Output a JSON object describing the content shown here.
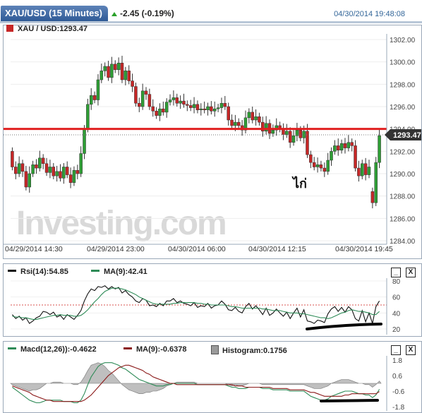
{
  "header": {
    "instrument_tab": "XAU/USD (15 Minutes)",
    "change": "-2.45 (-0.19%)",
    "timestamp": "04/30/2014 19:48:08"
  },
  "main_chart": {
    "symbol_label": "XAU / USD:1293.47",
    "last_price_tag": "1293.47",
    "annotation_text": "ไก่",
    "watermark": "Investing.com"
  },
  "rsi_panel": {
    "rsi_label": "Rsi(14):54.85",
    "ma_label": "MA(9):42.41"
  },
  "macd_panel": {
    "macd_label": "Macd(12,26)):-0.4622",
    "ma_label": "MA(9):-0.6378",
    "histogram_label": "Histogram:0.1756"
  },
  "buttons": {
    "minimize": "_",
    "close": "X"
  },
  "colors": {
    "bull": "#2e9e35",
    "bear": "#c62727",
    "support_line": "#e02020",
    "rsi_line": "#111111",
    "ma_line": "#2e8b57",
    "macd_signal": "#8b1a1a",
    "accent": "#336699"
  },
  "chart_data": [
    {
      "type": "candlestick",
      "title": "XAU / USD:1293.47",
      "x_tick_labels": [
        "04/29/2014 14:30",
        "04/29/2014 23:00",
        "04/30/2014 06:00",
        "04/30/2014 12:15",
        "04/30/2014 19:45"
      ],
      "y_tick_labels": [
        "1302.00",
        "1300.00",
        "1298.00",
        "1296.00",
        "1294.00",
        "1292.00",
        "1290.00",
        "1288.00",
        "1286.00",
        "1284.00"
      ],
      "ylim": [
        1284,
        1302
      ],
      "horizontal_line": 1294.0,
      "last_price": 1293.47,
      "close": [
        1290.6,
        1290.0,
        1290.9,
        1290.2,
        1288.8,
        1290.0,
        1290.8,
        1290.5,
        1291.4,
        1290.9,
        1290.1,
        1290.6,
        1289.8,
        1290.2,
        1289.6,
        1290.6,
        1289.9,
        1289.2,
        1290.3,
        1290.0,
        1291.8,
        1294.0,
        1296.2,
        1297.0,
        1296.6,
        1298.4,
        1299.2,
        1299.6,
        1298.6,
        1299.8,
        1299.3,
        1299.9,
        1298.4,
        1299.2,
        1298.3,
        1297.8,
        1296.3,
        1296.0,
        1297.4,
        1297.1,
        1296.0,
        1295.6,
        1295.2,
        1295.8,
        1295.5,
        1296.4,
        1296.6,
        1296.8,
        1296.3,
        1296.5,
        1296.2,
        1296.1,
        1295.9,
        1296.2,
        1295.7,
        1295.8,
        1295.7,
        1296.0,
        1295.6,
        1295.8,
        1295.9,
        1296.3,
        1296.0,
        1294.8,
        1294.3,
        1294.6,
        1294.3,
        1293.9,
        1295.0,
        1295.5,
        1294.8,
        1295.1,
        1294.6,
        1293.8,
        1294.5,
        1293.6,
        1293.9,
        1294.3,
        1294.0,
        1293.5,
        1293.8,
        1292.8,
        1293.4,
        1293.9,
        1293.2,
        1293.8,
        1291.7,
        1291.0,
        1290.6,
        1290.8,
        1290.5,
        1290.2,
        1291.2,
        1292.0,
        1292.5,
        1292.1,
        1292.7,
        1292.3,
        1292.8,
        1292.5,
        1290.5,
        1289.8,
        1290.9,
        1289.9,
        1290.6,
        1287.4,
        1291.0,
        1293.4
      ],
      "open": [
        1292.0,
        1290.6,
        1290.0,
        1290.9,
        1290.2,
        1288.8,
        1290.0,
        1290.8,
        1290.5,
        1291.4,
        1290.9,
        1290.1,
        1290.6,
        1289.8,
        1290.2,
        1289.6,
        1290.6,
        1289.9,
        1289.2,
        1290.3,
        1290.0,
        1291.8,
        1294.0,
        1296.2,
        1297.0,
        1296.6,
        1298.4,
        1299.2,
        1299.6,
        1298.6,
        1299.8,
        1299.3,
        1299.9,
        1298.4,
        1299.2,
        1298.3,
        1297.8,
        1296.3,
        1296.0,
        1297.4,
        1297.1,
        1296.0,
        1295.6,
        1295.2,
        1295.8,
        1295.5,
        1296.4,
        1296.6,
        1296.8,
        1296.3,
        1296.5,
        1296.2,
        1296.1,
        1295.9,
        1296.2,
        1295.7,
        1295.8,
        1295.7,
        1296.0,
        1295.6,
        1295.8,
        1295.9,
        1296.3,
        1296.0,
        1294.8,
        1294.3,
        1294.6,
        1294.3,
        1293.9,
        1295.0,
        1295.5,
        1294.8,
        1295.1,
        1294.6,
        1293.8,
        1294.5,
        1293.6,
        1293.9,
        1294.3,
        1294.0,
        1293.5,
        1293.8,
        1292.8,
        1293.4,
        1293.9,
        1293.2,
        1293.8,
        1291.7,
        1291.0,
        1290.6,
        1290.8,
        1290.5,
        1290.2,
        1291.2,
        1292.0,
        1292.5,
        1292.1,
        1292.7,
        1292.3,
        1292.8,
        1292.5,
        1290.5,
        1289.8,
        1290.9,
        1289.9,
        1288.4,
        1287.4,
        1291.0
      ]
    },
    {
      "type": "line",
      "title": "Rsi(14):54.85",
      "y_tick_labels": [
        "80",
        "60",
        "40",
        "20"
      ],
      "ylim": [
        20,
        80
      ],
      "reference_line": 50,
      "series": [
        {
          "name": "Rsi(14)",
          "values": [
            38,
            33,
            36,
            31,
            34,
            27,
            30,
            34,
            36,
            42,
            41,
            38,
            41,
            35,
            37,
            32,
            38,
            35,
            32,
            37,
            43,
            55,
            64,
            70,
            68,
            73,
            72,
            74,
            70,
            73,
            70,
            72,
            65,
            68,
            63,
            60,
            55,
            53,
            58,
            56,
            49,
            50,
            48,
            52,
            49,
            55,
            55,
            58,
            53,
            55,
            52,
            51,
            49,
            53,
            47,
            49,
            48,
            52,
            46,
            49,
            50,
            55,
            51,
            44,
            43,
            47,
            42,
            40,
            48,
            52,
            45,
            49,
            44,
            38,
            46,
            37,
            40,
            45,
            40,
            36,
            41,
            33,
            40,
            46,
            35,
            44,
            30,
            29,
            27,
            31,
            30,
            28,
            39,
            45,
            48,
            42,
            47,
            41,
            48,
            44,
            33,
            30,
            43,
            29,
            40,
            27,
            48,
            55
          ]
        },
        {
          "name": "MA(9)",
          "values": [
            36,
            35,
            35,
            34,
            34,
            33,
            32,
            32,
            33,
            34,
            35,
            36,
            37,
            37,
            38,
            37,
            37,
            37,
            36,
            36,
            37,
            40,
            44,
            49,
            54,
            58,
            63,
            67,
            69,
            71,
            71,
            71,
            70,
            69,
            67,
            65,
            63,
            60,
            58,
            56,
            54,
            52,
            51,
            51,
            51,
            51,
            51,
            52,
            52,
            53,
            53,
            53,
            53,
            53,
            52,
            52,
            51,
            51,
            50,
            50,
            50,
            50,
            50,
            49,
            48,
            48,
            47,
            46,
            46,
            46,
            46,
            46,
            46,
            45,
            45,
            44,
            43,
            43,
            43,
            42,
            41,
            40,
            40,
            40,
            39,
            39,
            38,
            37,
            36,
            35,
            34,
            34,
            33,
            34,
            36,
            38,
            40,
            41,
            43,
            44,
            43,
            42,
            42,
            41,
            40,
            38,
            38,
            42
          ]
        }
      ]
    },
    {
      "type": "line",
      "title": "Macd(12,26)):-0.4622",
      "y_tick_labels": [
        "1.8",
        "0.6",
        "-0.6",
        "-1.8"
      ],
      "ylim": [
        -1.8,
        1.8
      ],
      "series": [
        {
          "name": "Macd(12,26))",
          "values": [
            -0.3,
            -0.5,
            -0.7,
            -0.9,
            -1.1,
            -1.3,
            -1.4,
            -1.5,
            -1.5,
            -1.4,
            -1.3,
            -1.3,
            -1.3,
            -1.3,
            -1.3,
            -1.4,
            -1.4,
            -1.4,
            -1.5,
            -1.5,
            -1.3,
            -0.8,
            -0.1,
            0.5,
            0.9,
            1.3,
            1.5,
            1.6,
            1.6,
            1.6,
            1.5,
            1.4,
            1.2,
            1.1,
            0.9,
            0.7,
            0.5,
            0.3,
            0.2,
            0.1,
            0.0,
            -0.1,
            -0.2,
            -0.2,
            -0.2,
            -0.1,
            -0.1,
            0.0,
            0.0,
            0.0,
            0.0,
            0.0,
            0.0,
            0.0,
            -0.1,
            -0.1,
            -0.1,
            -0.1,
            -0.1,
            -0.1,
            -0.1,
            -0.1,
            -0.1,
            -0.2,
            -0.3,
            -0.3,
            -0.4,
            -0.4,
            -0.4,
            -0.3,
            -0.3,
            -0.3,
            -0.3,
            -0.4,
            -0.4,
            -0.4,
            -0.5,
            -0.5,
            -0.5,
            -0.5,
            -0.5,
            -0.6,
            -0.6,
            -0.6,
            -0.6,
            -0.6,
            -0.8,
            -1.0,
            -1.1,
            -1.2,
            -1.3,
            -1.3,
            -1.2,
            -1.0,
            -0.9,
            -0.8,
            -0.7,
            -0.6,
            -0.6,
            -0.6,
            -0.7,
            -0.8,
            -0.8,
            -0.9,
            -0.9,
            -1.1,
            -0.9,
            -0.46
          ]
        },
        {
          "name": "MA(9)",
          "values": [
            -0.2,
            -0.3,
            -0.4,
            -0.5,
            -0.6,
            -0.7,
            -0.9,
            -1.0,
            -1.1,
            -1.2,
            -1.3,
            -1.3,
            -1.4,
            -1.4,
            -1.4,
            -1.4,
            -1.4,
            -1.4,
            -1.4,
            -1.4,
            -1.4,
            -1.3,
            -1.1,
            -0.9,
            -0.6,
            -0.3,
            0.0,
            0.3,
            0.6,
            0.8,
            1.0,
            1.2,
            1.3,
            1.4,
            1.4,
            1.3,
            1.2,
            1.1,
            1.0,
            0.8,
            0.7,
            0.5,
            0.4,
            0.3,
            0.2,
            0.1,
            0.0,
            0.0,
            -0.1,
            -0.1,
            -0.1,
            -0.1,
            -0.1,
            -0.1,
            -0.1,
            -0.1,
            -0.1,
            -0.1,
            -0.1,
            -0.1,
            -0.1,
            -0.1,
            -0.1,
            -0.1,
            -0.1,
            -0.2,
            -0.2,
            -0.2,
            -0.3,
            -0.3,
            -0.3,
            -0.3,
            -0.3,
            -0.3,
            -0.3,
            -0.3,
            -0.4,
            -0.4,
            -0.4,
            -0.4,
            -0.4,
            -0.5,
            -0.5,
            -0.5,
            -0.5,
            -0.5,
            -0.6,
            -0.7,
            -0.7,
            -0.8,
            -0.9,
            -1.0,
            -1.0,
            -1.0,
            -1.0,
            -1.0,
            -1.0,
            -0.9,
            -0.9,
            -0.8,
            -0.8,
            -0.8,
            -0.8,
            -0.8,
            -0.8,
            -0.8,
            -0.8,
            -0.64
          ]
        },
        {
          "name": "Histogram",
          "values": [
            -0.1,
            -0.2,
            -0.3,
            -0.4,
            -0.5,
            -0.6,
            -0.5,
            -0.5,
            -0.4,
            -0.2,
            0.0,
            0.0,
            0.1,
            0.1,
            0.1,
            0.0,
            0.0,
            0.0,
            -0.1,
            -0.1,
            0.1,
            0.5,
            1.0,
            1.4,
            1.5,
            1.6,
            1.5,
            1.3,
            1.0,
            0.8,
            0.5,
            0.2,
            -0.1,
            -0.3,
            -0.5,
            -0.6,
            -0.7,
            -0.8,
            -0.8,
            -0.7,
            -0.7,
            -0.6,
            -0.6,
            -0.5,
            -0.4,
            -0.2,
            -0.1,
            0.0,
            0.1,
            0.1,
            0.1,
            0.1,
            0.1,
            0.1,
            0.0,
            0.0,
            0.0,
            0.0,
            0.0,
            0.0,
            0.0,
            0.0,
            0.0,
            -0.1,
            -0.2,
            -0.1,
            -0.2,
            -0.2,
            -0.1,
            0.0,
            0.0,
            0.0,
            0.0,
            -0.1,
            -0.1,
            -0.1,
            -0.1,
            -0.1,
            -0.1,
            -0.1,
            -0.1,
            -0.1,
            -0.1,
            -0.1,
            -0.1,
            -0.1,
            -0.2,
            -0.3,
            -0.4,
            -0.4,
            -0.4,
            -0.3,
            -0.2,
            0.0,
            0.1,
            0.2,
            0.3,
            0.3,
            0.3,
            0.2,
            0.1,
            0.0,
            0.0,
            -0.1,
            -0.1,
            -0.3,
            -0.1,
            0.18
          ]
        }
      ]
    }
  ]
}
